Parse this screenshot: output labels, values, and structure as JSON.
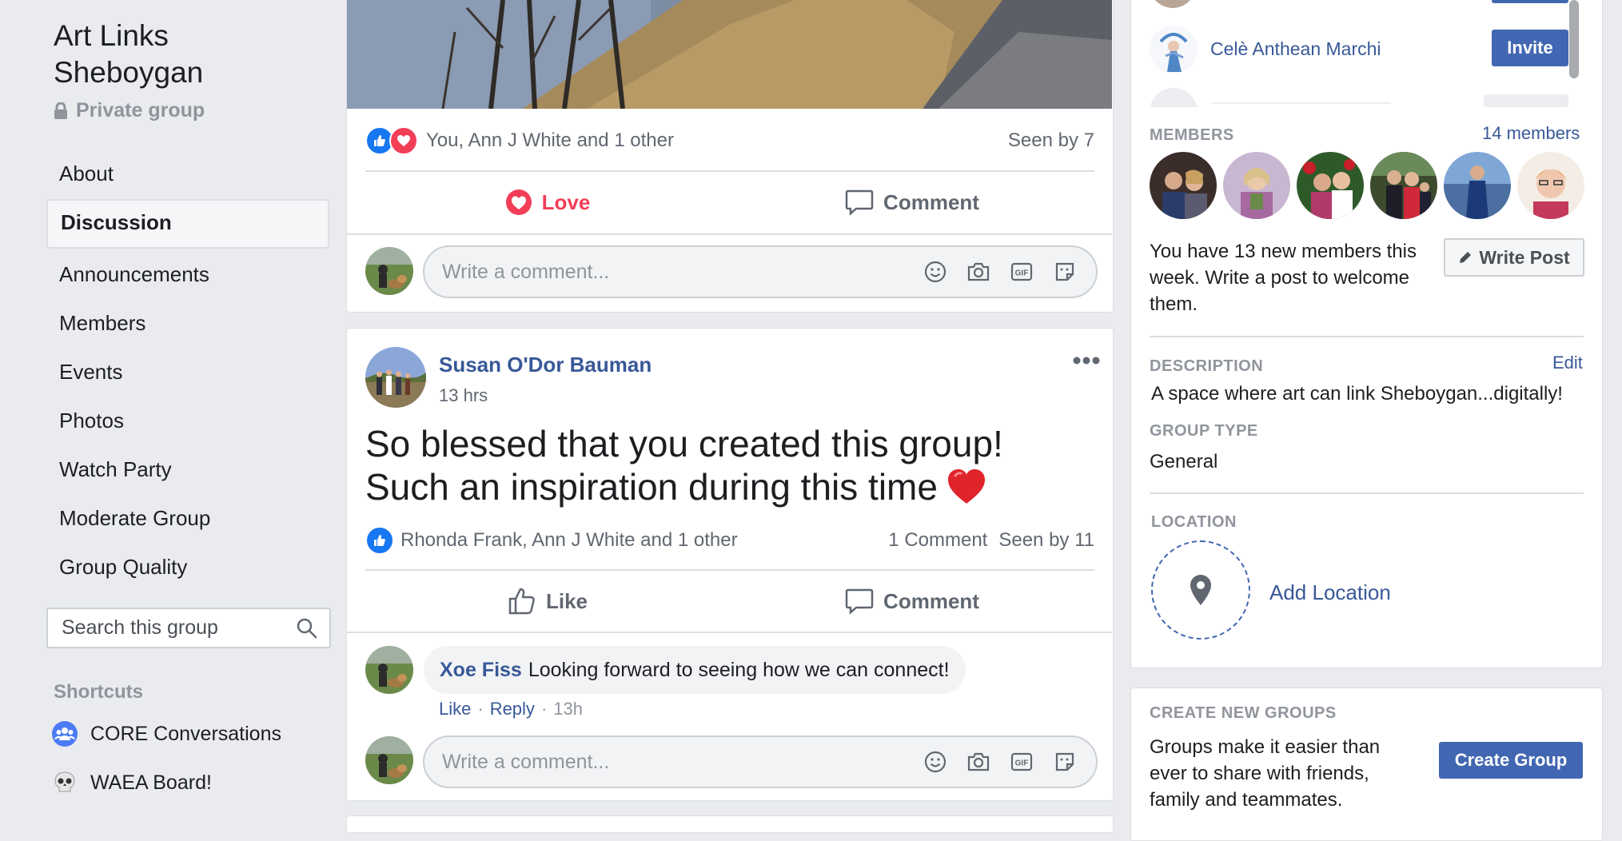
{
  "group": {
    "title": "Art Links Sheboygan",
    "privacy": "Private group"
  },
  "nav": {
    "items": [
      {
        "label": "About"
      },
      {
        "label": "Discussion"
      },
      {
        "label": "Announcements"
      },
      {
        "label": "Members"
      },
      {
        "label": "Events"
      },
      {
        "label": "Photos"
      },
      {
        "label": "Watch Party"
      },
      {
        "label": "Moderate Group"
      },
      {
        "label": "Group Quality"
      }
    ],
    "active_index": 1
  },
  "search": {
    "placeholder": "Search this group"
  },
  "shortcuts": {
    "title": "Shortcuts",
    "items": [
      {
        "label": "CORE Conversations",
        "icon": "group-icon"
      },
      {
        "label": "WAEA Board!",
        "icon": "skull-icon"
      }
    ]
  },
  "post1": {
    "reactions_text": "You, Ann J White and 1 other",
    "seen": "Seen by 7",
    "love_label": "Love",
    "comment_label": "Comment",
    "comment_placeholder": "Write a comment..."
  },
  "post2": {
    "author": "Susan O'Dor Bauman",
    "time": "13 hrs",
    "text_line1": "So blessed that you created this group!",
    "text_line2": "Such an inspiration during this time",
    "reactions_text": "Rhonda Frank, Ann J White and 1 other",
    "comment_count": "1 Comment",
    "seen": "Seen by 11",
    "like_label": "Like",
    "comment_label": "Comment",
    "comment": {
      "author": "Xoe Fiss",
      "text": "Looking forward to seeing how we can connect!",
      "like": "Like",
      "reply": "Reply",
      "time": "13h"
    },
    "comment_placeholder": "Write a comment..."
  },
  "right": {
    "invite": {
      "name": "Celè Anthean Marchi",
      "button": "Invite"
    },
    "members": {
      "title": "MEMBERS",
      "count_link": "14 members",
      "welcome_text": "You have 13 new members this week. Write a post to welcome them.",
      "write_post": "Write Post"
    },
    "description": {
      "title": "DESCRIPTION",
      "edit": "Edit",
      "text": "A space where art can link Sheboygan...digitally!"
    },
    "group_type": {
      "title": "GROUP TYPE",
      "value": "General"
    },
    "location": {
      "title": "LOCATION",
      "add": "Add Location"
    },
    "create_groups": {
      "title": "CREATE NEW GROUPS",
      "text": "Groups make it easier than ever to share with friends, family and teammates.",
      "button": "Create Group"
    }
  },
  "colors": {
    "brand": "#4267b2",
    "link": "#385898",
    "love": "#f33e58",
    "background": "#e9ebee"
  }
}
